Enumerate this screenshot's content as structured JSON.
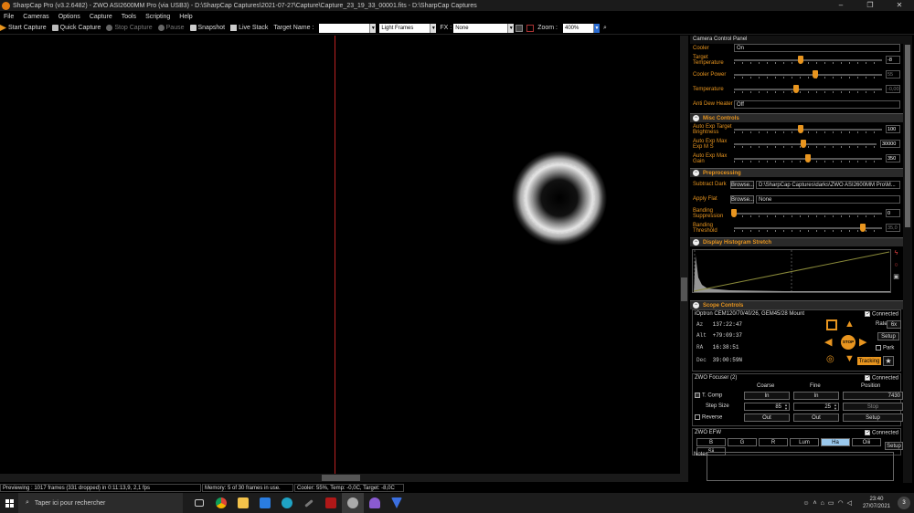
{
  "window": {
    "title": "SharpCap Pro (v3.2.6482) - ZWO ASI2600MM Pro (via USB3) - D:\\SharpCap Captures\\2021-07-27\\Capture\\Capture_23_19_33_00001.fits - D:\\SharpCap Captures",
    "controls": [
      "–",
      "❐",
      "✕"
    ]
  },
  "menu": [
    "File",
    "Cameras",
    "Options",
    "Capture",
    "Tools",
    "Scripting",
    "Help"
  ],
  "toolbar": {
    "start_capture": "Start Capture",
    "quick_capture": "Quick Capture",
    "stop_capture": "Stop Capture",
    "pause": "Pause",
    "snapshot": "Snapshot",
    "live_stack": "Live Stack",
    "target_name_label": "Target Name :",
    "target_name_value": "",
    "frame_type": "Light Frames",
    "fx_label": "FX :",
    "fx_value": "None",
    "zoom_label": "Zoom :",
    "zoom_value": "400%"
  },
  "status": {
    "preview": "Previewing : 1017 frames (331 dropped) in 0:11:13,9, 2,1 fps",
    "memory": "Memory: 5 of 30 frames in use.",
    "cooler": "Cooler: 55%, Temp: -0,0C, Target: -8,0C"
  },
  "panel": {
    "title": "Camera Control Panel",
    "camera": {
      "cooler_label": "Cooler",
      "cooler_value": "On",
      "target_temp_label": "Target Temperature",
      "target_temp_value": "-8",
      "target_temp_level": 0.45,
      "cooler_power_label": "Cooler Power",
      "cooler_power_value": "55",
      "cooler_power_level": 0.55,
      "temperature_label": "Temperature",
      "temperature_value": "-0,00",
      "temperature_level": 0.42,
      "anti_dew_label": "Anti Dew Heater",
      "anti_dew_value": "Off"
    },
    "misc": {
      "header": "Misc Controls",
      "brightness_label": "Auto Exp Target Brightness",
      "brightness_value": "100",
      "brightness_level": 0.45,
      "max_exp_label": "Auto Exp Max Exp M S",
      "max_exp_value": "30000",
      "max_exp_level": 0.49,
      "max_gain_label": "Auto Exp Max Gain",
      "max_gain_value": "350",
      "max_gain_level": 0.5
    },
    "preprocessing": {
      "header": "Preprocessing",
      "subtract_dark_label": "Subtract Dark",
      "subtract_dark_browse": "Browse...",
      "subtract_dark_value": "D:\\SharpCap Captures\\darks\\ZWO ASI2600MM Pro\\M...",
      "apply_flat_label": "Apply Flat",
      "apply_flat_browse": "Browse...",
      "apply_flat_value": "None",
      "banding_supp_label": "Banding Suppression",
      "banding_supp_value": "0",
      "banding_supp_level": 0.0,
      "banding_thr_label": "Banding Threshold",
      "banding_thr_value": "35,0",
      "banding_thr_level": 0.87
    },
    "histogram": {
      "header": "Display Histogram Stretch"
    },
    "scope": {
      "header": "Scope Controls",
      "mount": "iOptron CEM120/70/40/26, GEM45/28 Mount",
      "connected_label": "Connected",
      "az_label": "Az",
      "az_value": "137:22:47",
      "alt_label": "Alt",
      "alt_value": "+79:09:37",
      "ra_label": "RA",
      "ra_value": "16:38:51",
      "dec_label": "Dec",
      "dec_value": "39:00:59N",
      "rate_label": "Rate",
      "rate_value": "6x",
      "setup": "Setup",
      "park": "Park",
      "stop": "STOP",
      "tracking": "Tracking"
    },
    "focuser": {
      "header": "ZWO Focuser (2)",
      "connected_label": "Connected",
      "coarse": "Coarse",
      "fine": "Fine",
      "position": "Position",
      "t_comp": "T. Comp",
      "in_coarse": "In",
      "in_fine": "In",
      "position_value": "7430",
      "step_size": "Step Size",
      "step_coarse": "85",
      "step_fine": "25",
      "stop": "Stop",
      "reverse": "Reverse",
      "out_coarse": "Out",
      "out_fine": "Out",
      "setup": "Setup"
    },
    "efw": {
      "header": "ZWO EFW",
      "connected_label": "Connected",
      "filters": [
        "B",
        "G",
        "R",
        "Lum",
        "Ha",
        "Oiii"
      ],
      "filter_sii": "Sii",
      "selected": "Ha",
      "setup": "Setup"
    },
    "notes_label": "Notes"
  },
  "taskbar": {
    "search_placeholder": "Taper ici pour rechercher",
    "time": "23:40",
    "date": "27/07/2021",
    "notif_count": "3"
  },
  "colors": {
    "accent": "#e8951f",
    "cursor_line": "#b22222"
  }
}
